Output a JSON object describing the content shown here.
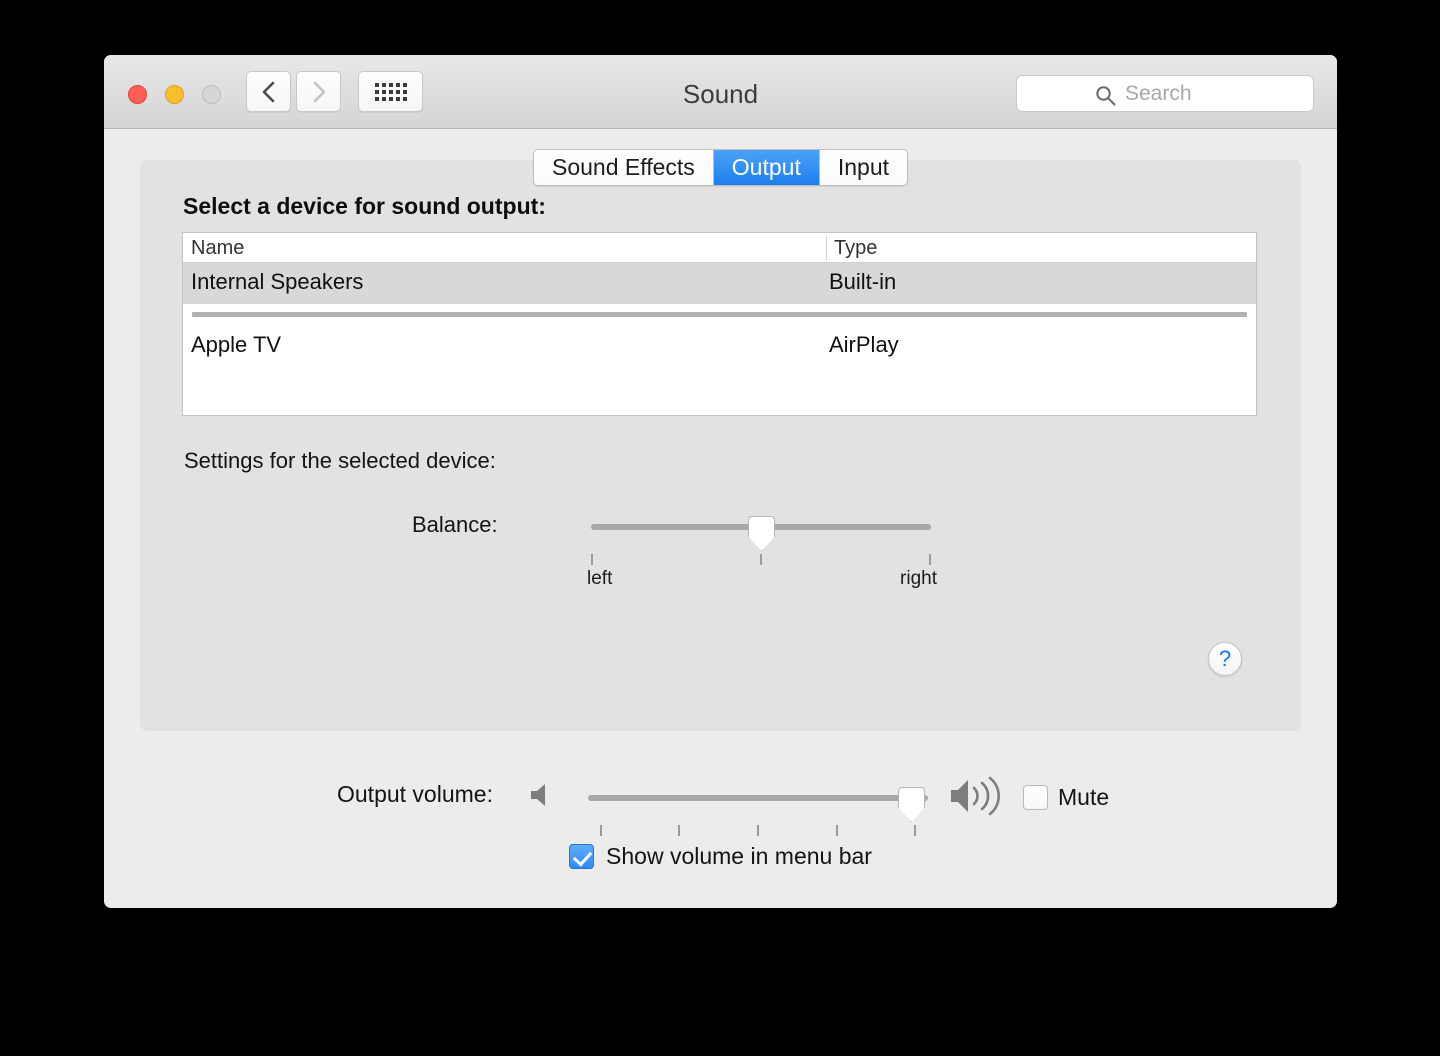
{
  "window": {
    "title": "Sound",
    "traffic_lights": [
      {
        "name": "close",
        "color": "#ff5f57"
      },
      {
        "name": "minimize",
        "color": "#f9bd30"
      },
      {
        "name": "zoom",
        "color": "#d6d6d6"
      }
    ],
    "nav": {
      "back_icon": "chevron-left-icon",
      "forward_icon": "chevron-right-icon",
      "show_all_icon": "grid-icon"
    },
    "search": {
      "placeholder": "Search",
      "value": "",
      "icon": "search-icon"
    }
  },
  "tabs": [
    {
      "label": "Sound Effects",
      "active": false
    },
    {
      "label": "Output",
      "active": true
    },
    {
      "label": "Input",
      "active": false
    }
  ],
  "panel": {
    "heading": "Select a device for sound output:",
    "table": {
      "columns": [
        "Name",
        "Type"
      ],
      "rows": [
        {
          "name": "Internal Speakers",
          "type": "Built-in",
          "selected": true
        },
        {
          "name": "Apple TV",
          "type": "AirPlay",
          "selected": false
        }
      ]
    },
    "settings_heading": "Settings for the selected device:",
    "balance": {
      "label": "Balance:",
      "left_label": "left",
      "right_label": "right",
      "value_percent": 50
    },
    "help_button": {
      "label": "?",
      "icon": "question-mark-icon"
    }
  },
  "footer": {
    "volume": {
      "label": "Output volume:",
      "value_percent": 95,
      "low_icon": "speaker-icon",
      "high_icon": "speaker-waves-icon"
    },
    "mute": {
      "label": "Mute",
      "checked": false
    },
    "show_in_menu_bar": {
      "label": "Show volume in menu bar",
      "checked": true
    }
  },
  "colors": {
    "accent": "#1c7fec",
    "window_bg": "#ececec",
    "panel_bg": "#e2e2e2",
    "selection": "#d8d8d8"
  }
}
